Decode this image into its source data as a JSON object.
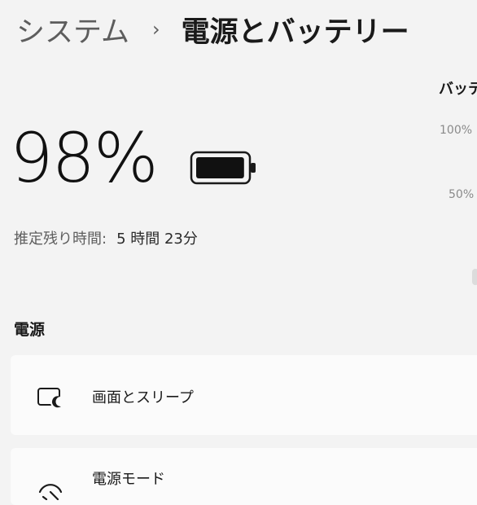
{
  "header": {
    "parent": "システム",
    "separator": "›",
    "current": "電源とバッテリー"
  },
  "battery": {
    "percent_text": "98%",
    "level": 0.98,
    "remaining_label": "推定残り時間:",
    "remaining_value": "5 時間 23分"
  },
  "chart": {
    "title": "バッテ",
    "tick_100": "100%",
    "tick_50": "50%"
  },
  "power_section": {
    "title": "電源",
    "items": [
      {
        "label": "画面とスリープ",
        "icon": "screen-sleep-icon"
      },
      {
        "label": "電源モード",
        "icon": "power-mode-icon"
      }
    ]
  }
}
